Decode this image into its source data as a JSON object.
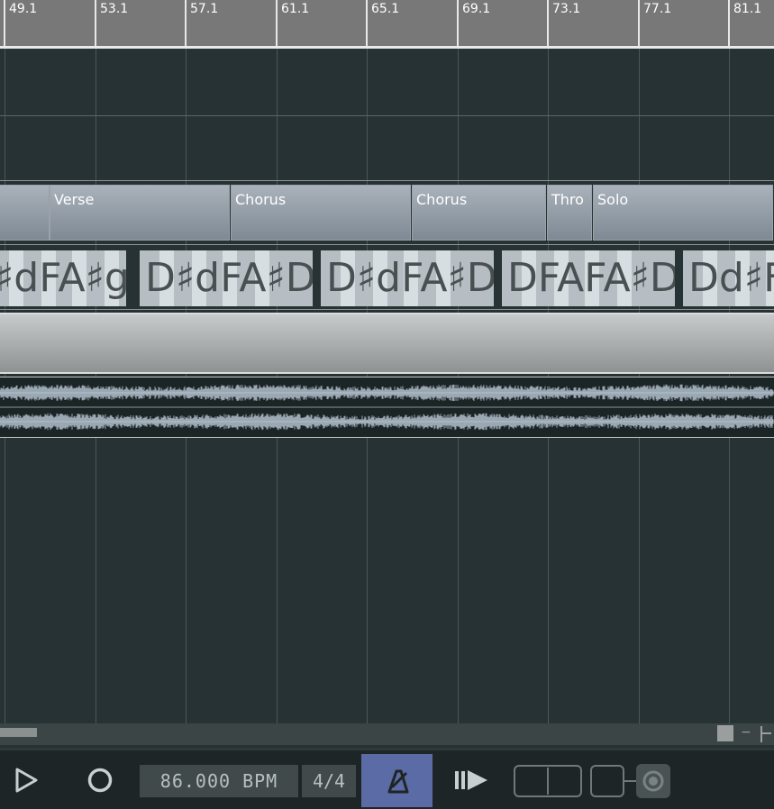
{
  "ruler": {
    "labels": [
      "49.1",
      "53.1",
      "57.1",
      "61.1",
      "65.1",
      "69.1",
      "73.1",
      "77.1",
      "81.1"
    ]
  },
  "sections": [
    {
      "label": ""
    },
    {
      "label": "Verse"
    },
    {
      "label": "Chorus"
    },
    {
      "label": "Chorus"
    },
    {
      "label": "Thro"
    },
    {
      "label": "Solo"
    }
  ],
  "chords": [
    {
      "label": "♯dFA♯g"
    },
    {
      "label": "D♯dFA♯D"
    },
    {
      "label": "D♯dFA♯D"
    },
    {
      "label": "DFAFA♯D"
    },
    {
      "label": "Dd♯F"
    }
  ],
  "transport": {
    "play_icon": "play-icon",
    "record_icon": "record-icon",
    "tempo": "86.000 BPM",
    "time_signature": "4/4",
    "metronome_icon": "metronome-icon",
    "skip_icon": "skip-forward-icon",
    "accent_color": "#5a6ba6"
  },
  "scroll": {
    "zoom_minus": "−"
  },
  "colors": {
    "background": "#263233",
    "ruler": "#777877",
    "section": "#8f99a2",
    "waveform": "#9aa8b4"
  }
}
